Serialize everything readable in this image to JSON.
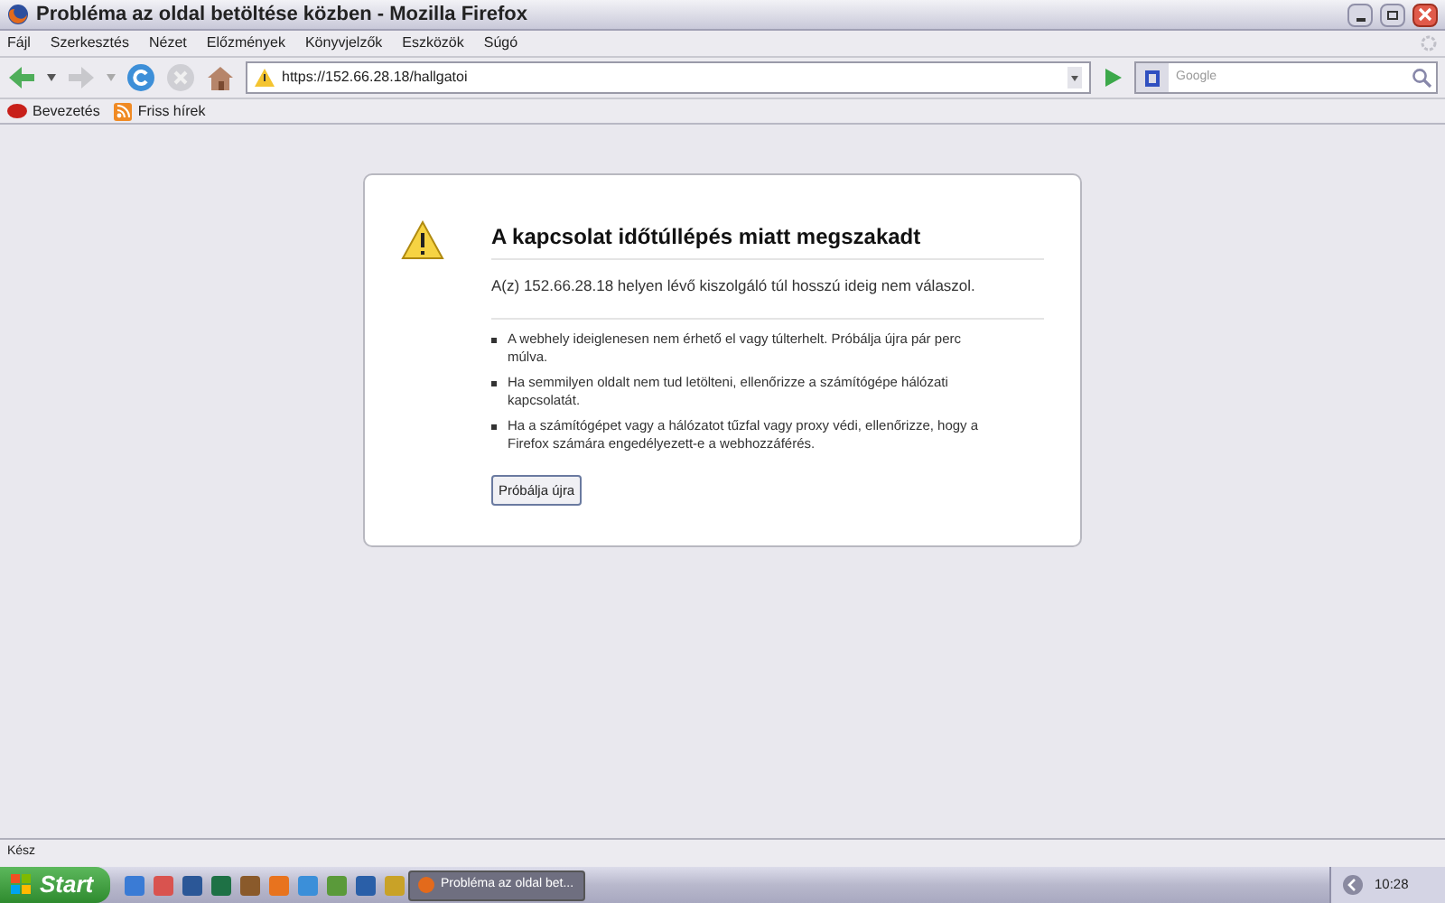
{
  "window": {
    "title": "Probléma az oldal betöltése közben - Mozilla Firefox"
  },
  "menu": [
    "Fájl",
    "Szerkesztés",
    "Nézet",
    "Előzmények",
    "Könyvjelzők",
    "Eszközök",
    "Súgó"
  ],
  "address": {
    "value": "https://152.66.28.18/hallgatoi"
  },
  "search": {
    "placeholder": "Google"
  },
  "bookmarks": [
    {
      "label": "Bevezetés",
      "kind": "page"
    },
    {
      "label": "Friss hírek",
      "kind": "feed"
    }
  ],
  "error": {
    "title": "A kapcsolat időtúllépés miatt megszakadt",
    "message": "A(z) 152.66.28.18 helyen lévő kiszolgáló túl hosszú ideig nem válaszol.",
    "tips": [
      "A webhely ideiglenesen nem érhető el vagy túlterhelt. Próbálja újra pár perc múlva.",
      "Ha semmilyen oldalt nem tud letölteni, ellenőrizze a számítógépe hálózati kapcsolatát.",
      "Ha a számítógépet vagy a hálózatot tűzfal vagy proxy védi, ellenőrizze, hogy a Firefox számára engedélyezett-e a webhozzáférés."
    ],
    "button": "Próbálja újra"
  },
  "status_bar": {
    "text": "Kész"
  },
  "taskbar": {
    "start": "Start",
    "tasks": [
      {
        "label": "Probléma az oldal bet...",
        "selected": true
      }
    ],
    "clock": "10:28"
  }
}
